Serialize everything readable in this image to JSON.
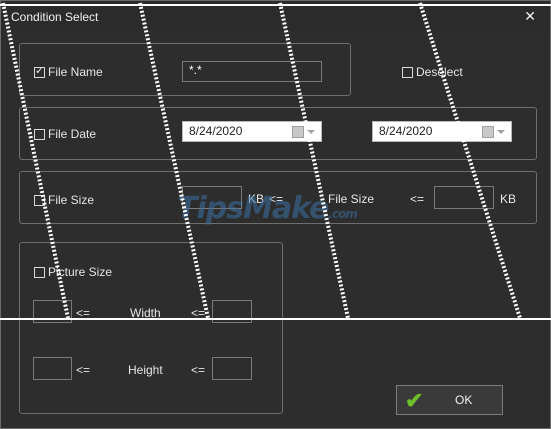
{
  "window": {
    "title": "Condition Select",
    "close_glyph": "✕"
  },
  "file_name": {
    "label": "File Name",
    "checked": true,
    "value": "*.*"
  },
  "deselect": {
    "label": "Deselect",
    "checked": false
  },
  "file_date": {
    "label": "File Date",
    "checked": false,
    "from": "8/24/2020",
    "to": "8/24/2020"
  },
  "file_size": {
    "label": "File Size",
    "checked": false,
    "unit1": "KB",
    "op1": "<=",
    "mid_label": "File Size",
    "op2": "<=",
    "unit2": "KB"
  },
  "picture_size": {
    "label": "Picture Size",
    "checked": false,
    "width": {
      "op1": "<=",
      "label": "Width",
      "op2": "<="
    },
    "height": {
      "op1": "<=",
      "label": "Height",
      "op2": "<="
    }
  },
  "ok": {
    "label": "OK"
  },
  "watermark": "TipsMake.com"
}
